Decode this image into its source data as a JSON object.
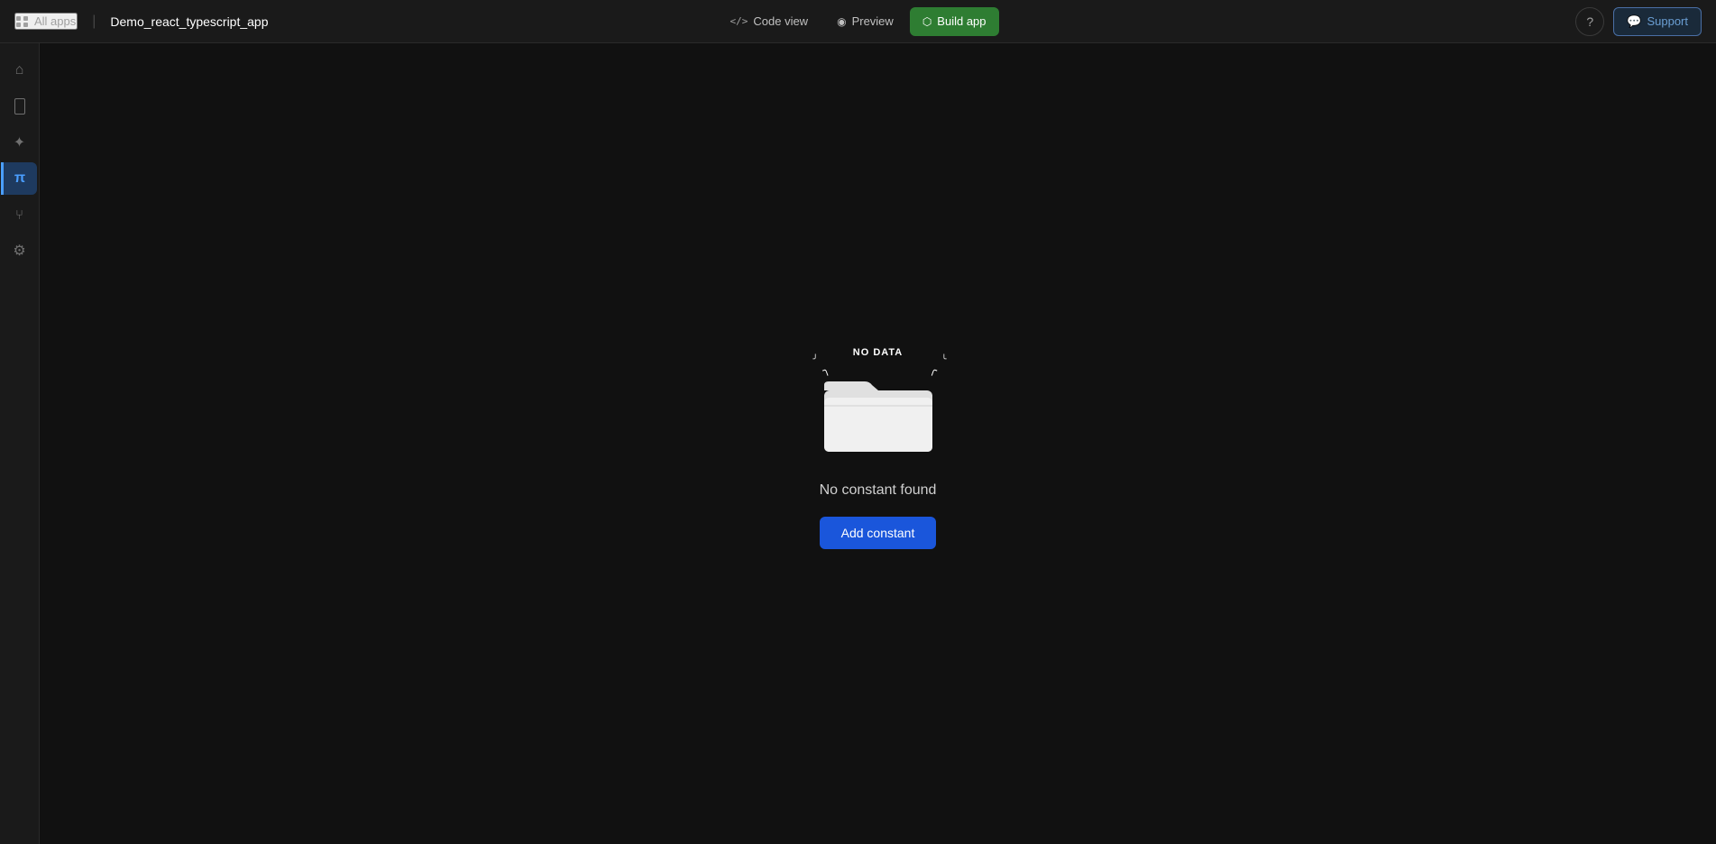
{
  "topbar": {
    "all_apps_label": "All apps",
    "app_name": "Demo_react_typescript_app",
    "divider": "|",
    "code_view_label": "Code view",
    "preview_label": "Preview",
    "build_app_label": "Build app",
    "help_icon": "?",
    "support_label": "Support"
  },
  "sidebar": {
    "items": [
      {
        "id": "home",
        "icon": "home-icon",
        "label": "Home"
      },
      {
        "id": "mobile",
        "icon": "mobile-icon",
        "label": "Mobile"
      },
      {
        "id": "sparkle",
        "icon": "sparkle-icon",
        "label": "Sparkle"
      },
      {
        "id": "constants",
        "icon": "pi-icon",
        "label": "Constants",
        "active": true
      },
      {
        "id": "branch",
        "icon": "branch-icon",
        "label": "Branch"
      },
      {
        "id": "settings",
        "icon": "settings-icon",
        "label": "Settings"
      }
    ]
  },
  "empty_state": {
    "no_data_label": "NO DATA",
    "title": "No constant found",
    "add_button_label": "Add constant"
  }
}
